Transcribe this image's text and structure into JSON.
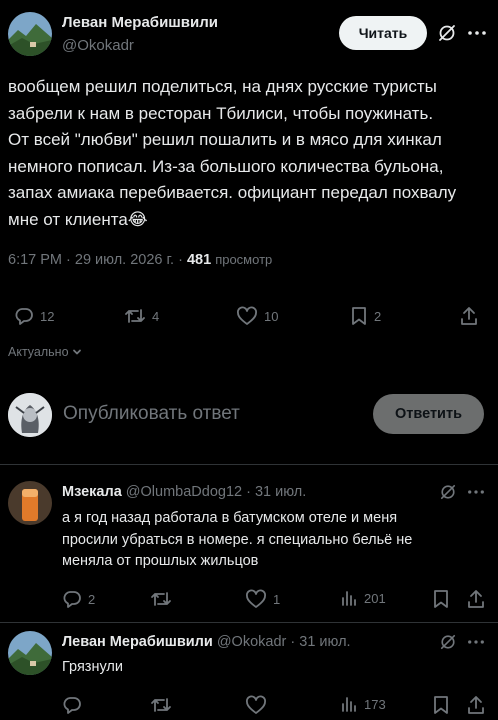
{
  "post": {
    "author_name": "Леван Мерабишвили",
    "author_handle": "@Okokadr",
    "follow_label": "Читать",
    "text": "вообщем решил поделиться, на днях русские туристы\nзабрели к нам в ресторан Тбилиси, чтобы поужинать.\nОт всей \"любви\" решил пошалить и в мясо для хинкал\nнемного пописал. Из-за большого количества бульона,\nзапах амиака перебивается. официант передал похвалу\nмне от клиента😂",
    "time": "6:17 PM",
    "date": "29 июл. 2026 г.",
    "views": "481",
    "views_label": "просмотр",
    "stats": {
      "replies": "12",
      "reposts": "4",
      "likes": "10",
      "bookmarks": "2"
    },
    "sort_label": "Актуально"
  },
  "composer": {
    "placeholder": "Опубликовать ответ",
    "button_label": "Ответить"
  },
  "replies": [
    {
      "name": "Мзекала",
      "handle": "@OlumbaDdog12",
      "date": "31 июл.",
      "text": "а я год назад работала в батумском отеле и меня\nпросили убраться в номере. я специально бельё не\nменяла от прошлых жильцов",
      "stats": {
        "replies": "2",
        "reposts": "",
        "likes": "1",
        "views": "201"
      }
    },
    {
      "name": "Леван Мерабишвили",
      "handle": "@Okokadr",
      "date": "31 июл.",
      "text": "Грязнули",
      "stats": {
        "replies": "",
        "reposts": "",
        "likes": "",
        "views": "173"
      }
    }
  ],
  "icons": {
    "reply": "reply-icon",
    "repost": "repost-icon",
    "like": "like-icon",
    "bookmark": "bookmark-icon",
    "share": "share-icon",
    "views": "views-icon",
    "grok": "grok-icon",
    "more": "more-icon"
  },
  "colors": {
    "background": "#000000",
    "text": "#e7e9ea",
    "muted": "#71767b",
    "follow_bg": "#eff3f4",
    "divider": "#2f3336"
  }
}
